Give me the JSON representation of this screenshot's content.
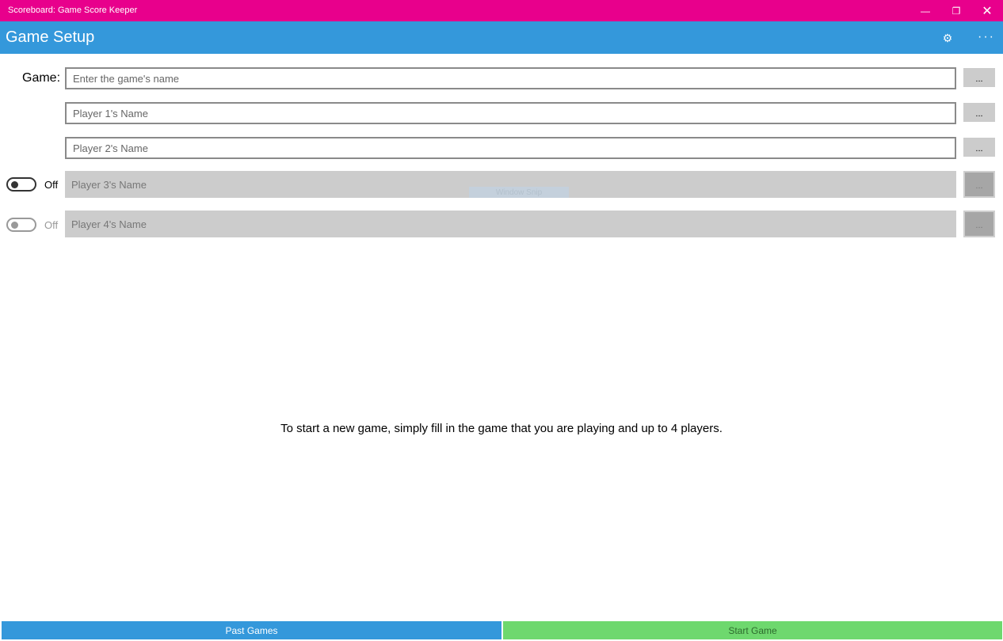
{
  "window": {
    "title": "Scoreboard: Game Score Keeper",
    "minimize_glyph": "—",
    "maximize_glyph": "❐",
    "close_glyph": "✕"
  },
  "header": {
    "page_title": "Game Setup",
    "settings_icon": "gear-icon",
    "settings_glyph": "⚙",
    "more_glyph": "···"
  },
  "form": {
    "game_label": "Game:",
    "game_placeholder": "Enter the game's name",
    "player1_placeholder": "Player 1's Name",
    "player2_placeholder": "Player 2's Name",
    "player3_placeholder": "Player 3's Name",
    "player4_placeholder": "Player 4's Name",
    "dots_label": "...",
    "player3_toggle_label": "Off",
    "player4_toggle_label": "Off"
  },
  "overlay": {
    "snip_label": "Window Snip"
  },
  "hint_text": "To start a new game, simply fill in the game that you are playing and up to 4 players.",
  "footer": {
    "past_games_label": "Past Games",
    "start_game_label": "Start Game"
  },
  "colors": {
    "titlebar": "#e8008c",
    "header": "#3498db",
    "past_games": "#3498db",
    "start_game": "#6ed86e"
  }
}
